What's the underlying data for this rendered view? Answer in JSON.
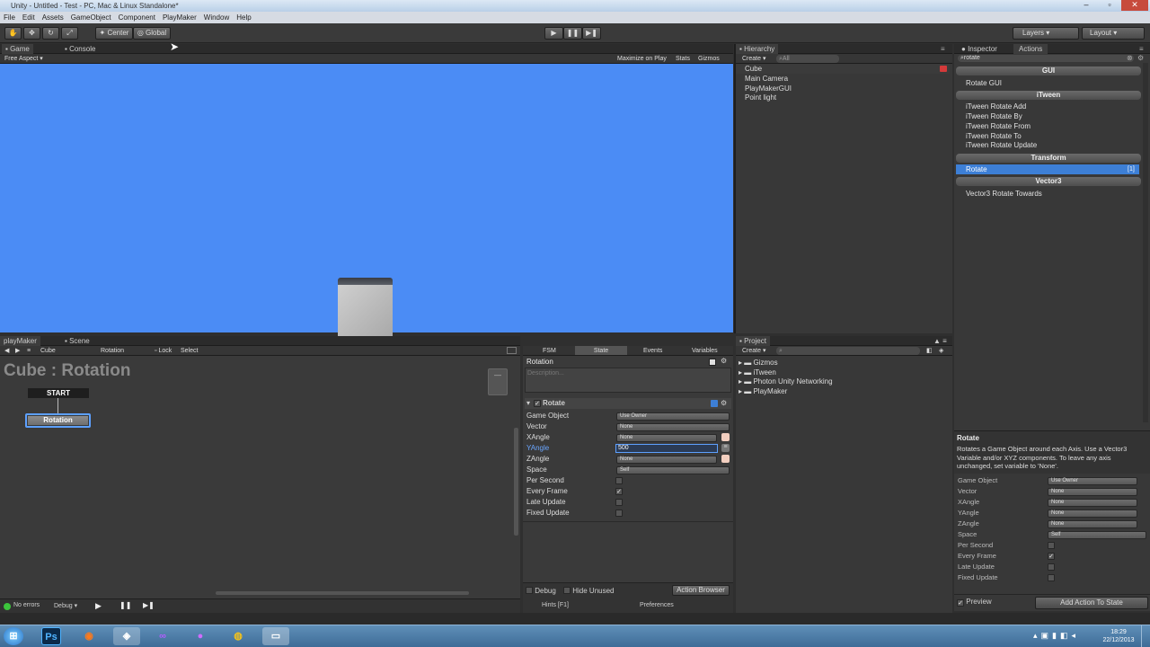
{
  "window": {
    "title": "Unity - Untitled - Test - PC, Mac & Linux Standalone*"
  },
  "menu": [
    "File",
    "Edit",
    "Assets",
    "GameObject",
    "Component",
    "PlayMaker",
    "Window",
    "Help"
  ],
  "toolbar": {
    "center": "Center",
    "global": "Global",
    "layers": "Layers",
    "layout": "Layout"
  },
  "game": {
    "tabs": [
      "Game",
      "Console"
    ],
    "aspect": "Free Aspect",
    "options": [
      "Maximize on Play",
      "Stats",
      "Gizmos"
    ],
    "viewport_color": "#4b8cf5"
  },
  "hierarchy": {
    "tab": "Hierarchy",
    "create": "Create",
    "search": "All",
    "items": [
      "Cube",
      "Main Camera",
      "PlayMakerGUI",
      "Point light"
    ]
  },
  "inspector": {
    "tabs": [
      "Inspector",
      "Actions"
    ],
    "search": "rotate",
    "categories": [
      {
        "header": "GUI",
        "items": [
          "Rotate GUI"
        ]
      },
      {
        "header": "iTween",
        "items": [
          "iTween Rotate Add",
          "iTween Rotate By",
          "iTween Rotate From",
          "iTween Rotate To",
          "iTween Rotate Update"
        ]
      },
      {
        "header": "Transform",
        "items": [
          "Rotate"
        ]
      },
      {
        "header": "Vector3",
        "items": [
          "Vector3 Rotate Towards"
        ]
      }
    ],
    "selected_badge": "[1]",
    "desc_title": "Rotate",
    "desc_text": "Rotates a Game Object around each Axis. Use a Vector3 Variable and/or XYZ components. To leave any axis unchanged, set variable to 'None'.",
    "props": [
      {
        "label": "Game Object",
        "value": "Use Owner"
      },
      {
        "label": "Vector",
        "value": "None"
      },
      {
        "label": "XAngle",
        "value": "None"
      },
      {
        "label": "YAngle",
        "value": "None"
      },
      {
        "label": "ZAngle",
        "value": "None"
      },
      {
        "label": "Space",
        "value": "Self"
      }
    ],
    "checks": [
      {
        "label": "Per Second",
        "checked": false
      },
      {
        "label": "Every Frame",
        "checked": true
      },
      {
        "label": "Late Update",
        "checked": false
      },
      {
        "label": "Fixed Update",
        "checked": false
      }
    ],
    "preview": "Preview",
    "add_action": "Add Action To State"
  },
  "playmaker": {
    "tabs": [
      "playMaker",
      "Scene"
    ],
    "bar": {
      "object": "Cube",
      "fsm": "Rotation",
      "lock": "Lock",
      "select": "Select"
    },
    "graph_title": "Cube : Rotation",
    "start": "START",
    "state": "Rotation",
    "footer": {
      "errors": "No errors",
      "debug": "Debug"
    }
  },
  "state_panel": {
    "tabs": [
      "FSM",
      "State",
      "Events",
      "Variables"
    ],
    "state_name": "Rotation",
    "description": "Description...",
    "action_title": "Rotate",
    "props": [
      {
        "label": "Game Object",
        "value": "Use Owner"
      },
      {
        "label": "Vector",
        "value": "None"
      },
      {
        "label": "XAngle",
        "value": "None"
      },
      {
        "label": "YAngle",
        "value": "500"
      },
      {
        "label": "ZAngle",
        "value": "None"
      },
      {
        "label": "Space",
        "value": "Self"
      }
    ],
    "checks": [
      {
        "label": "Per Second",
        "checked": false
      },
      {
        "label": "Every Frame",
        "checked": true
      },
      {
        "label": "Late Update",
        "checked": false
      },
      {
        "label": "Fixed Update",
        "checked": false
      }
    ],
    "debug": "Debug",
    "hide_unused": "Hide Unused",
    "action_browser": "Action Browser",
    "hints": "Hints [F1]",
    "preferences": "Preferences"
  },
  "project": {
    "tab": "Project",
    "create": "Create",
    "folders": [
      "Gizmos",
      "iTween",
      "Photon Unity Networking",
      "PlayMaker"
    ]
  },
  "taskbar": {
    "time": "18:29",
    "date": "22/12/2013"
  }
}
